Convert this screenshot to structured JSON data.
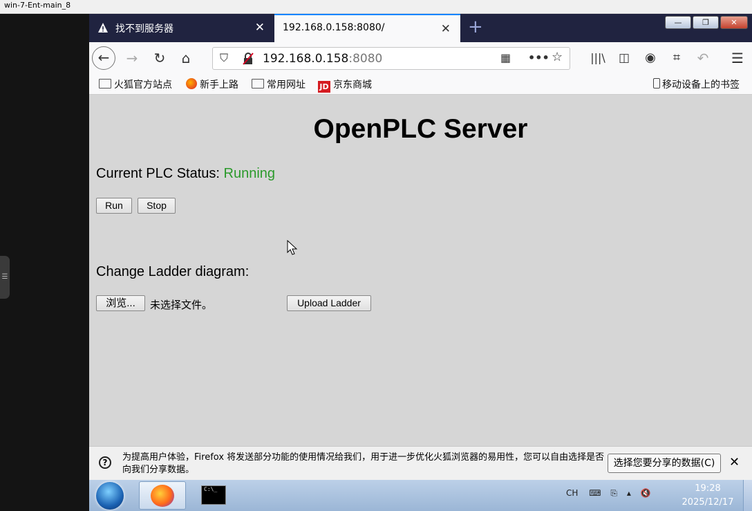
{
  "vm": {
    "title": "win-7-Ent-main_8"
  },
  "browser": {
    "tabs": [
      {
        "label": "找不到服务器",
        "close": "✕"
      },
      {
        "label": "192.168.0.158:8080/",
        "close": "✕"
      }
    ],
    "new_tab": "+",
    "window_buttons": {
      "minimize": "—",
      "restore": "❐",
      "close": "✕"
    },
    "url": {
      "host": "192.168.0.158",
      "port": ":8080"
    },
    "bookmarks": [
      "火狐官方站点",
      "新手上路",
      "常用网址",
      "京东商城"
    ],
    "jd_icon_text": "JD",
    "mobile_bookmarks": "移动设备上的书签"
  },
  "page": {
    "title": "OpenPLC Server",
    "status_label": "Current PLC Status: ",
    "status_value": "Running",
    "run_button": "Run",
    "stop_button": "Stop",
    "ladder_heading": "Change Ladder diagram:",
    "browse_button": "浏览...",
    "no_file": "未选择文件。",
    "upload_button": "Upload Ladder",
    "status_color": "#2b9a2b"
  },
  "notification": {
    "text": "为提高用户体验，Firefox 将发送部分功能的使用情况给我们，用于进一步优化火狐浏览器的易用性，您可以自由选择是否向我们分享数据。",
    "button": "选择您要分享的数据(C)",
    "close": "✕",
    "icon": "?"
  },
  "taskbar": {
    "cmd_text": "C:\\_",
    "ime": "CH",
    "time": "19:28",
    "date": "2025/12/17"
  }
}
